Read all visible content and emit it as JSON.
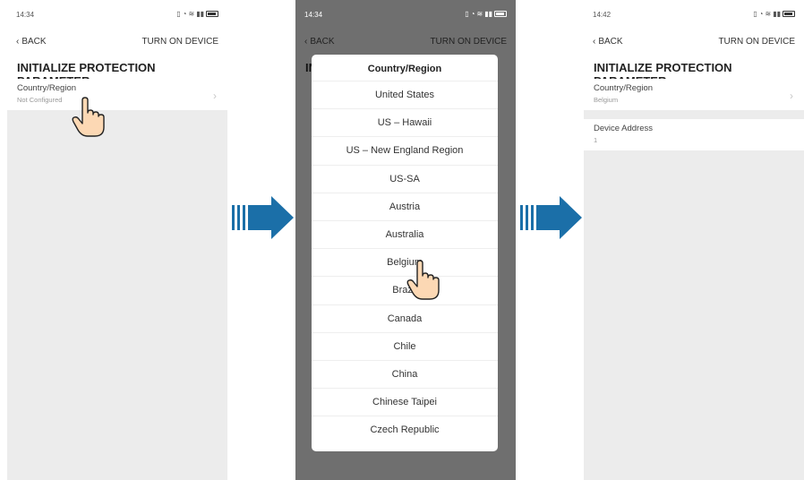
{
  "screens": [
    {
      "status_time": "14:34",
      "back": "BACK",
      "turn_on": "TURN ON DEVICE",
      "title": "INITIALIZE PROTECTION PARAMETER",
      "rows": [
        {
          "label": "Country/Region",
          "value": "Not Configured"
        }
      ]
    },
    {
      "status_time": "14:34",
      "back": "BACK",
      "turn_on": "TURN ON DEVICE",
      "title_peek": "IN",
      "dialog": {
        "title": "Country/Region",
        "options": [
          "United States",
          "US – Hawaii",
          "US – New England Region",
          "US-SA",
          "Austria",
          "Australia",
          "Belgium",
          "Brazil",
          "Canada",
          "Chile",
          "China",
          "Chinese Taipei",
          "Czech Republic"
        ]
      }
    },
    {
      "status_time": "14:42",
      "back": "BACK",
      "turn_on": "TURN ON DEVICE",
      "title": "INITIALIZE PROTECTION PARAMETER",
      "rows": [
        {
          "label": "Country/Region",
          "value": "Belgium"
        },
        {
          "label": "Device Address",
          "value": "1"
        }
      ]
    }
  ],
  "colors": {
    "arrow": "#1b6fa8",
    "hand_fill": "#fcd8b4",
    "overlay": "#6f6f6f"
  }
}
